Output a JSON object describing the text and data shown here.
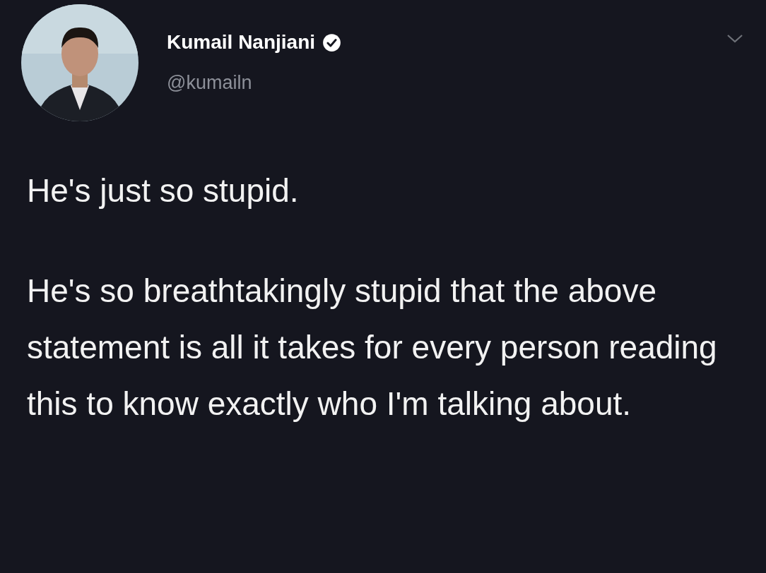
{
  "tweet": {
    "author": {
      "name": "Kumail Nanjiani",
      "handle": "@kumailn",
      "verified": true
    },
    "paragraphs": [
      "He's just so stupid.",
      "He's so breathtakingly stupid that the above statement is all it takes for every person reading this to know exactly who I'm talking about."
    ]
  }
}
